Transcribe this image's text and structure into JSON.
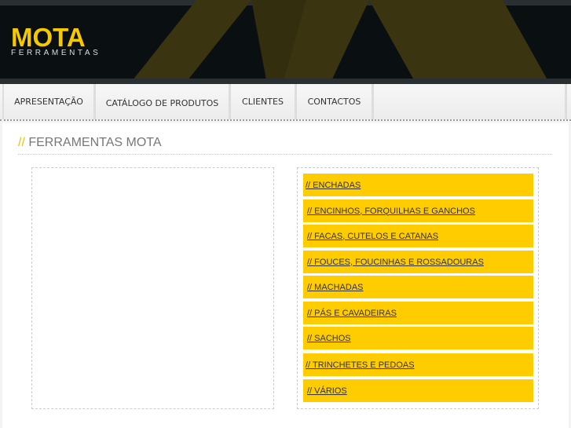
{
  "logo": {
    "main": "MOTA",
    "sub": "FERRAMENTAS"
  },
  "nav": [
    {
      "label": "APRESENTAÇÃO"
    },
    {
      "label": "CATÁLOGO DE PRODUTOS"
    },
    {
      "label": "CLIENTES"
    },
    {
      "label": "CONTACTOS"
    }
  ],
  "page": {
    "prefix": "//",
    "title": "FERRAMENTAS MOTA"
  },
  "categories": [
    {
      "label": "// ENCHADAS"
    },
    {
      "label": "// ENCINHOS, FORQUILHAS E GANCHOS"
    },
    {
      "label": "// FACAS, CUTELOS E CATANAS"
    },
    {
      "label": "// FOUCES, FOUCINHAS E ROSSADOURAS"
    },
    {
      "label": "// MACHADAS"
    },
    {
      "label": "// PÁS E CAVADEIRAS"
    },
    {
      "label": "// SACHOS"
    },
    {
      "label": "// TRINCHETES E PEDOAS"
    },
    {
      "label": "// VÁRIOS"
    }
  ],
  "colors": {
    "accent": "#ffcc00",
    "header": "#0a1012"
  }
}
